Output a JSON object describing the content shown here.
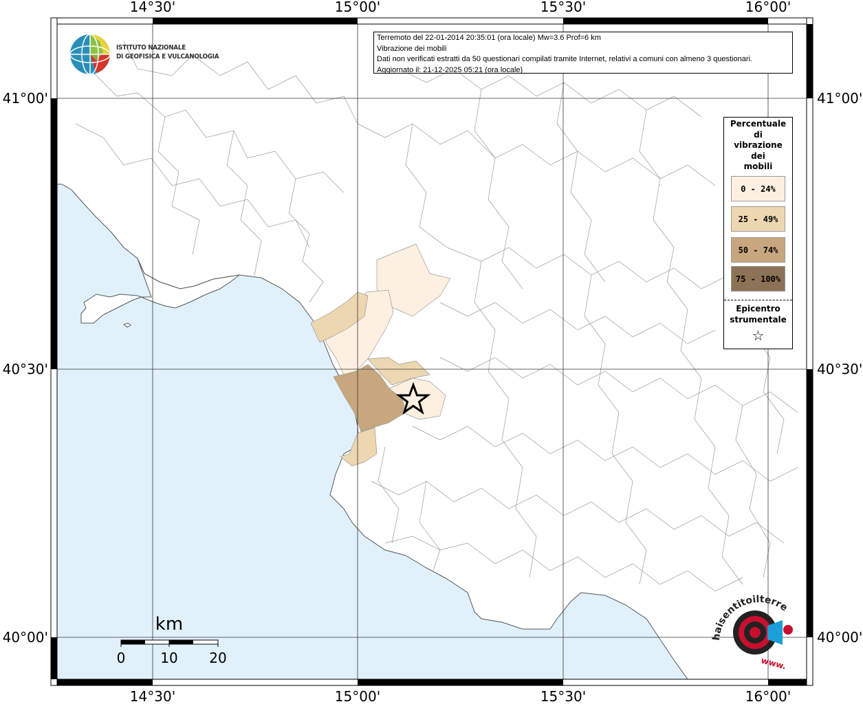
{
  "map": {
    "lon_labels_top": [
      "14°30'",
      "15°00'",
      "15°30'",
      "16°00'"
    ],
    "lon_labels_bottom": [
      "14°30'",
      "15°00'",
      "15°30'",
      "16°00'"
    ],
    "lat_labels_left": [
      "41°00'",
      "40°30'",
      "40°00'"
    ],
    "lat_labels_right": [
      "41°00'",
      "40°30'",
      "40°00'"
    ],
    "sea_color": "#e0f1fc",
    "land_color": "#ffffff"
  },
  "info": {
    "line1": "Terremoto del 22-01-2014 20:35:01 (ora locale) Mw=3.6 Prof=6 km",
    "line2": "Vibrazione dei mobili",
    "line3": "Dati non verificati estratti da 50 questionari compilati tramite Internet, relativi a comuni con almeno 3 questionari.",
    "line4": "Aggiornato il: 21-12-2025 05:21 (ora locale)"
  },
  "legend": {
    "title_lines": [
      "Percentuale",
      "di",
      "vibrazione",
      "dei",
      "mobili"
    ],
    "classes": [
      {
        "label": "0 - 24%",
        "color": "#fdf0e0"
      },
      {
        "label": "25 - 49%",
        "color": "#edd7b0"
      },
      {
        "label": "50 - 74%",
        "color": "#c8a77f"
      },
      {
        "label": "75 - 100%",
        "color": "#8c7256"
      }
    ],
    "epicenter_lines": [
      "Epicentro",
      "strumentale"
    ],
    "epicenter_symbol": "☆"
  },
  "scale_bar": {
    "unit": "km",
    "ticks": [
      "0",
      "10",
      "20"
    ]
  },
  "logos": {
    "ingv_line1": "ISTITUTO NAZIONALE",
    "ingv_line2": "DI GEOFISICA E VULCANOLOGIA",
    "hst_text": "haisentitoilterremoto.it",
    "hst_url": "www."
  }
}
